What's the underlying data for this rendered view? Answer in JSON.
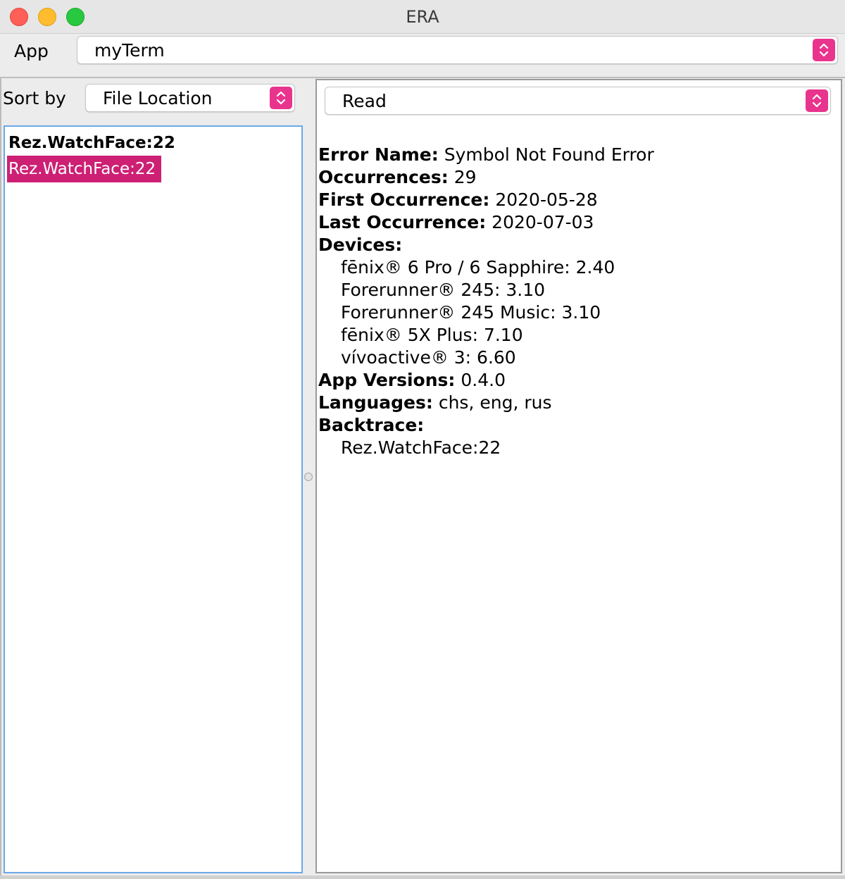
{
  "window": {
    "title": "ERA"
  },
  "app_row": {
    "label": "App",
    "selected": "myTerm"
  },
  "left_pane": {
    "sort_label": "Sort by",
    "sort_selected": "File Location",
    "items": [
      {
        "text": "Rez.WatchFace:22",
        "style": "bold"
      },
      {
        "text": "Rez.WatchFace:22",
        "style": "selected"
      }
    ]
  },
  "right_pane": {
    "status_selected": "Read",
    "details": {
      "error_name_label": "Error Name:",
      "error_name": "Symbol Not Found Error",
      "occurrences_label": "Occurrences:",
      "occurrences": "29",
      "first_occurrence_label": "First Occurrence:",
      "first_occurrence": "2020-05-28",
      "last_occurrence_label": "Last Occurrence:",
      "last_occurrence": "2020-07-03",
      "devices_label": "Devices:",
      "devices": [
        "fēnix® 6 Pro / 6 Sapphire: 2.40",
        "Forerunner® 245: 3.10",
        "Forerunner® 245 Music: 3.10",
        "fēnix® 5X Plus: 7.10",
        "vívoactive® 3: 6.60"
      ],
      "app_versions_label": "App Versions:",
      "app_versions": "0.4.0",
      "languages_label": "Languages:",
      "languages": "chs, eng, rus",
      "backtrace_label": "Backtrace:",
      "backtrace": [
        "Rez.WatchFace:22"
      ]
    }
  },
  "colors": {
    "accent": "#e9348d",
    "selection": "#cd2074",
    "list_border": "#6aa9e9"
  }
}
